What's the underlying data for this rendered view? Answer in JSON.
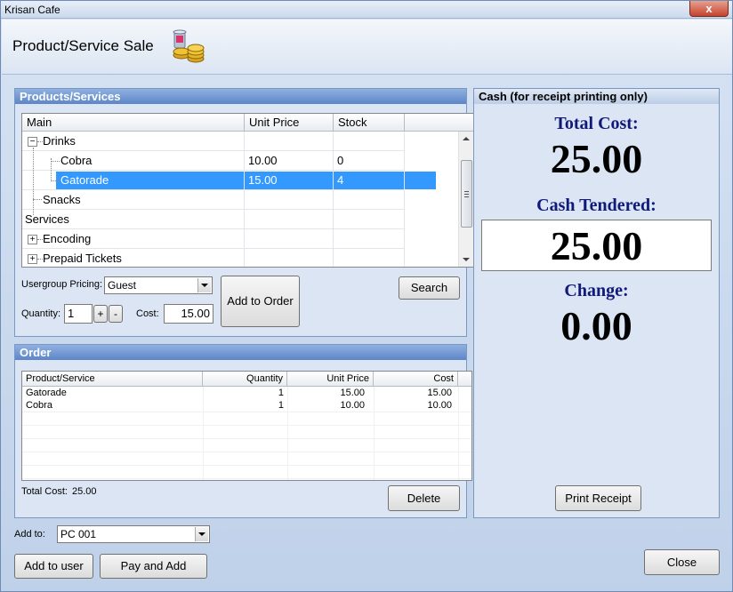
{
  "window": {
    "title": "Krisan Cafe",
    "close_glyph": "x"
  },
  "header": {
    "title": "Product/Service Sale",
    "icon": "cafe-cup-coins-icon"
  },
  "products": {
    "group_title": "Products/Services",
    "columns": [
      "Main",
      "Unit Price",
      "Stock"
    ],
    "rows": [
      {
        "label": "Drinks",
        "price": "",
        "stock": ""
      },
      {
        "label": "Cobra",
        "price": "10.00",
        "stock": "0"
      },
      {
        "label": "Gatorade",
        "price": "15.00",
        "stock": "4"
      },
      {
        "label": "Snacks",
        "price": "",
        "stock": ""
      },
      {
        "label": "Services",
        "price": "",
        "stock": ""
      },
      {
        "label": "Encoding",
        "price": "",
        "stock": ""
      },
      {
        "label": "Prepaid Tickets",
        "price": "",
        "stock": ""
      }
    ],
    "usergroup_label": "Usergroup Pricing:",
    "usergroup_value": "Guest",
    "quantity_label": "Quantity:",
    "quantity_value": "1",
    "plus": "+",
    "minus": "-",
    "cost_label": "Cost:",
    "cost_value": "15.00",
    "add_to_order": "Add to Order",
    "search": "Search"
  },
  "order": {
    "group_title": "Order",
    "columns": [
      "Product/Service",
      "Quantity",
      "Unit Price",
      "Cost"
    ],
    "rows": [
      {
        "product": "Gatorade",
        "quantity": "1",
        "unit_price": "15.00",
        "cost": "15.00"
      },
      {
        "product": "Cobra",
        "quantity": "1",
        "unit_price": "10.00",
        "cost": "10.00"
      }
    ],
    "total_label": "Total Cost:",
    "total_value": "25.00",
    "delete": "Delete"
  },
  "cash": {
    "group_title": "Cash (for receipt printing only)",
    "total_cost_label": "Total Cost:",
    "total_cost_value": "25.00",
    "tendered_label": "Cash Tendered:",
    "tendered_value": "25.00",
    "change_label": "Change:",
    "change_value": "0.00",
    "print_receipt": "Print Receipt"
  },
  "footer": {
    "add_to_label": "Add to:",
    "add_to_value": "PC 001",
    "add_to_user": "Add to user",
    "pay_and_add": "Pay and Add",
    "close": "Close"
  }
}
